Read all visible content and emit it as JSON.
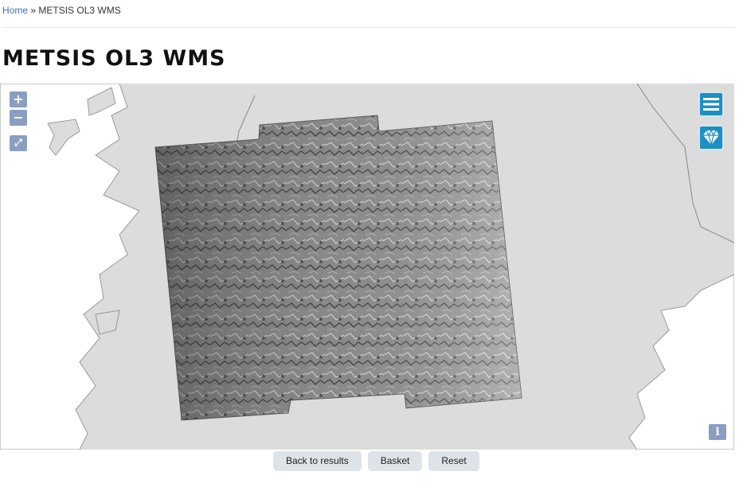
{
  "breadcrumb": {
    "home": "Home",
    "separator": " » ",
    "current": "METSIS OL3 WMS"
  },
  "page_title": "METSIS OL3 WMS",
  "map": {
    "zoom_in": "+",
    "zoom_out": "−",
    "fullscreen": "⤢",
    "info": "i",
    "land_color": "#dcdcdc",
    "water_color": "#ffffff",
    "button_color": "#1e8fc2"
  },
  "actions": {
    "back": "Back to results",
    "basket": "Basket",
    "reset": "Reset"
  }
}
